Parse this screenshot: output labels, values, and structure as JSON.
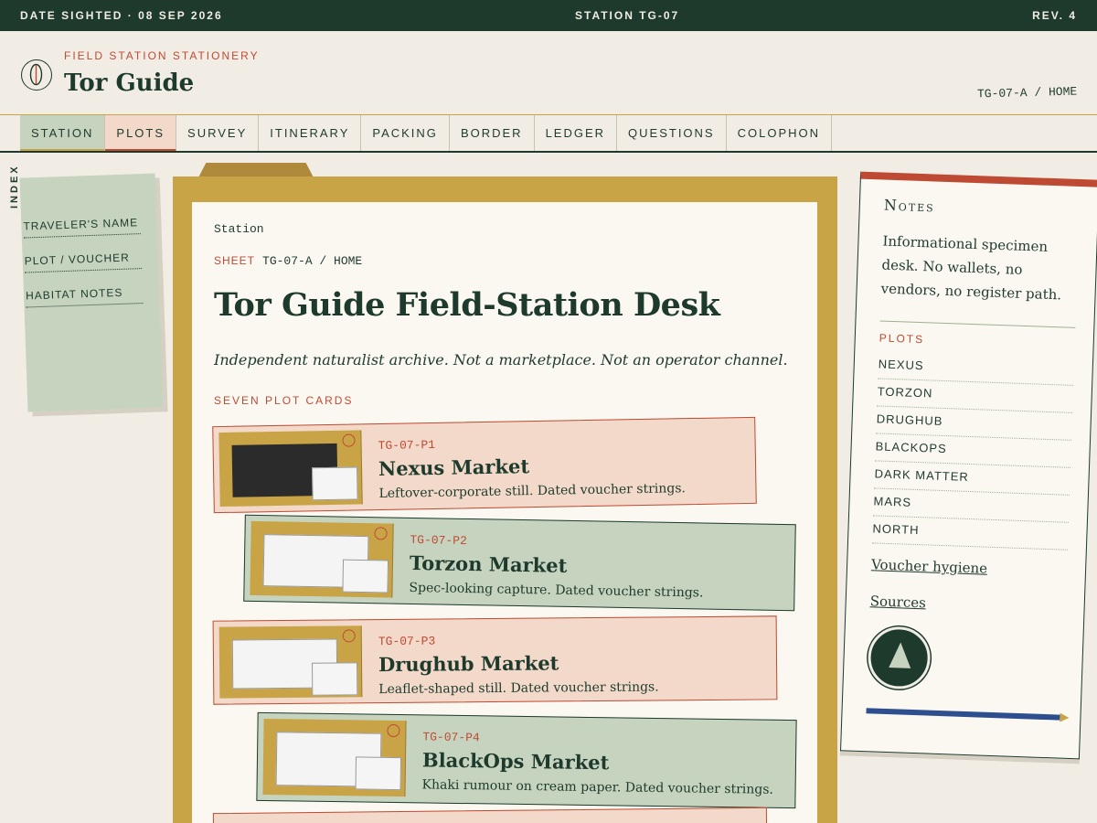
{
  "topbar": {
    "date": "DATE SIGHTED · 08 SEP 2026",
    "station": "STATION TG-07",
    "rev": "REV. 4"
  },
  "masthead": {
    "eyebrow": "FIELD STATION STATIONERY",
    "brand": "Tor Guide",
    "crumb": "TG-07-A / HOME",
    "emblem_icon": "leaf-emblem-icon"
  },
  "nav": [
    "STATION",
    "PLOTS",
    "SURVEY",
    "ITINERARY",
    "PACKING",
    "BORDER",
    "LEDGER",
    "QUESTIONS",
    "COLOPHON"
  ],
  "index": {
    "tab": "INDEX",
    "items": [
      "TRAVELER'S NAME",
      "PLOT / VOUCHER",
      "HABITAT NOTES"
    ]
  },
  "sheet": {
    "label": "Station",
    "sheet_key": "SHEET",
    "sheet_val": "TG-07-A / HOME",
    "title": "Tor Guide Field-Station Desk",
    "desc": "Independent naturalist archive. Not a marketplace. Not an operator channel.",
    "sub": "SEVEN PLOT CARDS"
  },
  "cards": [
    {
      "code": "TG-07-P1",
      "name": "Nexus Market",
      "line": "Leftover-corporate still. Dated voucher strings."
    },
    {
      "code": "TG-07-P2",
      "name": "Torzon Market",
      "line": "Spec-looking capture. Dated voucher strings."
    },
    {
      "code": "TG-07-P3",
      "name": "Drughub Market",
      "line": "Leaflet-shaped still. Dated voucher strings."
    },
    {
      "code": "TG-07-P4",
      "name": "BlackOps Market",
      "line": "Khaki rumour on cream paper. Dated voucher strings."
    }
  ],
  "notes": {
    "heading": "Notes",
    "para": "Informational specimen desk. No wallets, no vendors, no register path.",
    "plots_key": "PLOTS",
    "plots": [
      "NEXUS",
      "TORZON",
      "DRUGHUB",
      "BLACKOPS",
      "DARK MATTER",
      "MARS",
      "NORTH"
    ],
    "link1": "Voucher hygiene",
    "link2": "Sources",
    "badge_icon": "triangle-badge-icon"
  },
  "colors": {
    "forest": "#1d3a2c",
    "rust": "#bf4a33",
    "mustard": "#c9a447",
    "sage": "#c6d4bf",
    "peach": "#f3d9c9",
    "paper": "#f1ede5"
  }
}
